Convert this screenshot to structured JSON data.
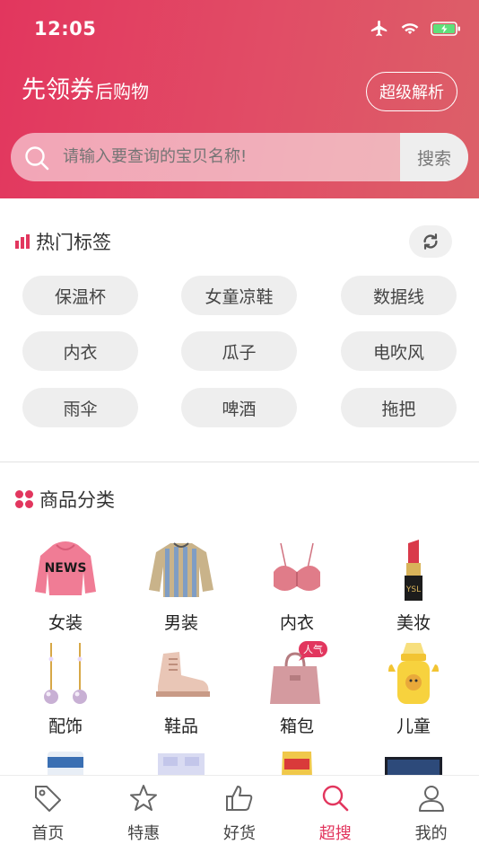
{
  "status_bar": {
    "time": "12:05"
  },
  "header": {
    "brand_main": "先领券",
    "brand_sub": "后购物",
    "parse_button": "超级解析",
    "search_placeholder": "请输入要查询的宝贝名称!",
    "search_button": "搜索"
  },
  "hot_tags": {
    "title": "热门标签",
    "tags": [
      "保温杯",
      "女童凉鞋",
      "数据线",
      "内衣",
      "瓜子",
      "电吹风",
      "雨伞",
      "啤酒",
      "拖把"
    ]
  },
  "categories": {
    "title": "商品分类",
    "items": [
      {
        "label": "女装",
        "icon": "hoodie-icon"
      },
      {
        "label": "男装",
        "icon": "sweater-icon"
      },
      {
        "label": "内衣",
        "icon": "bra-icon"
      },
      {
        "label": "美妆",
        "icon": "lipstick-icon"
      },
      {
        "label": "配饰",
        "icon": "earrings-icon"
      },
      {
        "label": "鞋品",
        "icon": "boot-icon"
      },
      {
        "label": "箱包",
        "icon": "handbag-icon",
        "badge": "人气"
      },
      {
        "label": "儿童",
        "icon": "baby-bottle-icon"
      }
    ]
  },
  "tab_bar": {
    "tabs": [
      {
        "label": "首页",
        "icon": "tag-icon"
      },
      {
        "label": "特惠",
        "icon": "star-icon"
      },
      {
        "label": "好货",
        "icon": "thumbs-up-icon"
      },
      {
        "label": "超搜",
        "icon": "search-icon",
        "active": true
      },
      {
        "label": "我的",
        "icon": "user-icon"
      }
    ]
  },
  "colors": {
    "accent": "#e2365e",
    "header_end": "#dc6068"
  }
}
